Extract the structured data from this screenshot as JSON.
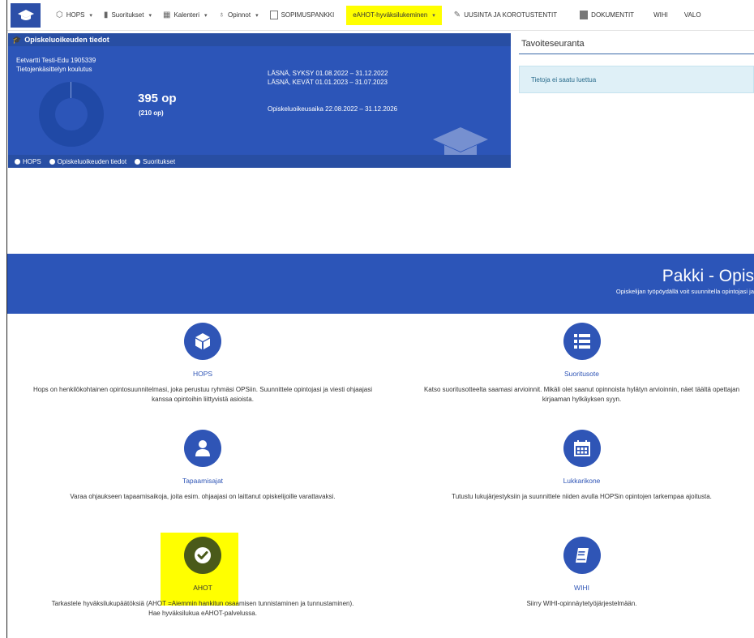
{
  "nav": {
    "items": [
      {
        "label": "HOPS",
        "icon": "cube-icon",
        "dropdown": true
      },
      {
        "label": "Suoritukset",
        "icon": "bar-chart-icon",
        "dropdown": true
      },
      {
        "label": "Kalenteri",
        "icon": "calendar-icon",
        "dropdown": true
      },
      {
        "label": "Opinnot",
        "icon": "lightbulb-icon",
        "dropdown": true
      },
      {
        "label": "SOPIMUSPANKKI",
        "icon": "document-icon",
        "dropdown": false
      },
      {
        "label": "eAHOT-hyväksilukeminen",
        "icon": "",
        "dropdown": true,
        "highlight": true
      },
      {
        "label": "UUSINTA JA KOROTUSTENTIT",
        "icon": "edit-icon",
        "dropdown": false
      },
      {
        "label": "DOKUMENTIT",
        "icon": "file-icon",
        "dropdown": false
      },
      {
        "label": "WIHI",
        "icon": "",
        "dropdown": false
      },
      {
        "label": "VALO",
        "icon": "",
        "dropdown": false
      }
    ]
  },
  "study_card": {
    "title": "Opiskeluoikeuden tiedot",
    "student_name": "Eetvartti Testi-Edu 1905339",
    "programme": "Tietojenkäsittelyn koulutus",
    "credits": "395 op",
    "credits_required": "(210 op)",
    "period_1": "LÄSNÄ, SYKSY 01.08.2022 – 31.12.2022",
    "period_2": "LÄSNÄ, KEVÄT 01.01.2023 – 31.07.2023",
    "duration": "Opiskeluoikeusaika 22.08.2022 – 31.12.2026",
    "links": [
      "HOPS",
      "Opiskeluoikeuden tiedot",
      "Suoritukset"
    ]
  },
  "goals": {
    "title": "Tavoiteseuranta",
    "info": "Tietoja ei saatu luettua"
  },
  "banner": {
    "title": "Pakki - Opis",
    "subtitle": "Opiskelijan työpöydällä voit suunnitella opintojasi ja"
  },
  "tiles": {
    "hops": {
      "title": "HOPS",
      "icon": "cube-icon",
      "desc": "Hops on henkilökohtainen opintosuunnitelmasi, joka perustuu ryhmäsi OPSiin. Suunnittele opintojasi ja viesti ohjaajasi kanssa opintoihin liittyvistä asioista."
    },
    "suoritusote": {
      "title": "Suoritusote",
      "icon": "list-icon",
      "desc": "Katso suoritusotteelta saamasi arvioinnit. Mikäli olet saanut opinnoista hylätyn arvioinnin, näet täältä opettajan kirjaaman hylkäyksen syyn."
    },
    "tapaamisajat": {
      "title": "Tapaamisajat",
      "icon": "user-icon",
      "desc": "Varaa ohjaukseen tapaamisaikoja, joita esim. ohjaajasi on laittanut opiskelijoille varattavaksi."
    },
    "lukkarikone": {
      "title": "Lukkarikone",
      "icon": "calendar-icon",
      "desc": "Tutustu lukujärjestyksiin ja suunnittele niiden avulla HOPSin opintojen tarkempaa ajoitusta."
    },
    "ahot": {
      "title": "AHOT",
      "icon": "check-icon",
      "desc_1": "Tarkastele hyväksilukupäätöksiä (AHOT =Aiemmin hankitun osaamisen tunnistaminen ja tunnustaminen).",
      "desc_2": "Hae hyväksilukua eAHOT-palvelussa."
    },
    "wihi": {
      "title": "WIHI",
      "icon": "book-icon",
      "desc": "Siirry WIHI-opinnäytetyöjärjestelmään."
    }
  },
  "colors": {
    "brand": "#2c55b8",
    "highlight": "#ffff00",
    "info_bg": "#dff0f7",
    "ahot_circle": "#4a5a1a"
  }
}
